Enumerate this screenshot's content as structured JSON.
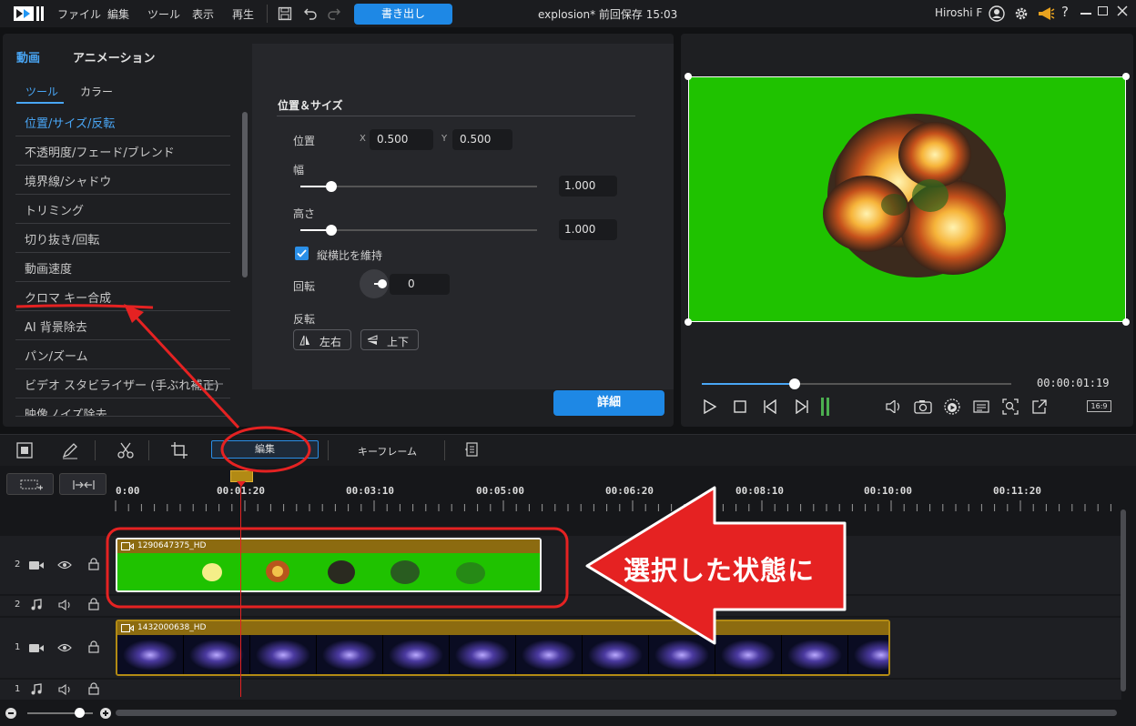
{
  "topbar": {
    "menus": [
      "ファイル",
      "編集",
      "ツール",
      "表示",
      "再生"
    ],
    "export_label": "書き出し",
    "project_title": "explosion* 前回保存 15:03",
    "user_name": "Hiroshi F"
  },
  "edit_panel": {
    "tabs": [
      "動画",
      "アニメーション"
    ],
    "subtabs": [
      "ツール",
      "カラー"
    ],
    "tools": [
      "位置/サイズ/反転",
      "不透明度/フェード/ブレンド",
      "境界線/シャドウ",
      "トリミング",
      "切り抜き/回転",
      "動画速度",
      "クロマ キー合成",
      "AI 背景除去",
      "パン/ズーム",
      "ビデオ スタビライザー (手ぶれ補正)",
      "映像ノイズ除去"
    ],
    "section_title": "位置＆サイズ",
    "position_label": "位置",
    "x_label": "X",
    "x_value": "0.500",
    "y_label": "Y",
    "y_value": "0.500",
    "width_label": "幅",
    "width_value": "1.000",
    "width_slider": 0.13,
    "height_label": "高さ",
    "height_value": "1.000",
    "height_slider": 0.13,
    "aspect_label": "縦横比を維持",
    "rotation_label": "回転",
    "rotation_value": "0",
    "flip_label": "反転",
    "flip_horizontal": "左右",
    "flip_vertical": "上下",
    "detail_button": "詳細"
  },
  "preview": {
    "timecode": "00:00:01:19",
    "aspect": "16:9",
    "progress": 0.3
  },
  "timeline": {
    "toolbar_edit": "編集",
    "toolbar_keyframe": "キーフレーム",
    "ruler": [
      "0:00",
      "00:01:20",
      "00:03:10",
      "00:05:00",
      "00:06:20",
      "00:08:10",
      "00:10:00",
      "00:11:20"
    ],
    "tracks": [
      {
        "num": "2",
        "type": "video"
      },
      {
        "num": "2",
        "type": "audio"
      },
      {
        "num": "1",
        "type": "video"
      },
      {
        "num": "1",
        "type": "audio"
      }
    ],
    "clip_top": "1290647375_HD",
    "clip_bottom": "1432000638_HD"
  },
  "annotation": {
    "arrow_text": "選択した状態に",
    "color": "#e52222"
  }
}
